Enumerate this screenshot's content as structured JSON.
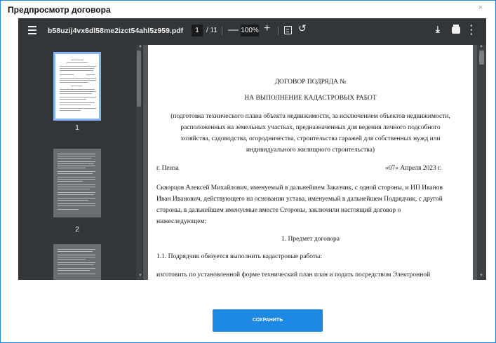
{
  "dialog": {
    "title": "Предпросмотр договора",
    "close": "×",
    "save_label": "СОХРАНИТЬ"
  },
  "viewer": {
    "filename": "b58uzij4vx6dl58me2izct54ahl5z959.pdf",
    "page_current": "1",
    "page_total": "/ 11",
    "zoom": "100%"
  },
  "thumbnails": [
    {
      "number": "1"
    },
    {
      "number": "2"
    }
  ],
  "document": {
    "title": "ДОГОВОР ПОДРЯДА №",
    "subtitle": "НА ВЫПОЛНЕНИЕ КАДАСТРОВЫХ РАБОТ",
    "intro_lines": [
      "(подготовка технического плана объекта недвижимости, за исключением объектов недвижимости,",
      "расположенных на земельных участках, предназначенных для ведения личного подсобного",
      "хозяйства, садоводства, огородничества, строительства гаражей для собственных нужд или",
      "индивидуального жилищного строительства)"
    ],
    "city": "г. Пенза",
    "date": "«07» Апреля 2023 г.",
    "parties_lines": [
      "Скворцов Алексей Михайлович, именуемый в дальнейшем Заказчик, с одной стороны, и ИП Иванов",
      "Иван Иванович, действующего на основании устава, именуемый в дальнейшем Подрядчик, с другой",
      "стороны, в дальнейшем именуемые вместе Стороны, заключили настоящий договор о",
      "нижеследующем:"
    ],
    "section_title": "1. Предмет договора",
    "clause_1_1": "1.1. Подрядчик обязуется выполнить кадастровые работы:",
    "clause_text": "изготовить по установленной форме технический план план и подать посредством Электронной"
  }
}
